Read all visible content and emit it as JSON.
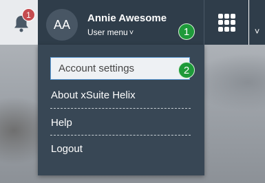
{
  "notifications": {
    "count": "1",
    "icon": "bell-icon"
  },
  "user": {
    "initials": "AA",
    "name": "Annie Awesome",
    "menu_label": "User menu",
    "menu_chevron": "˅"
  },
  "markers": {
    "one": "1",
    "two": "2"
  },
  "apps": {
    "icon": "app-grid-icon",
    "chevron": "˅"
  },
  "user_menu_items": {
    "account_settings": "Account settings",
    "about": "About xSuite Helix",
    "help": "Help",
    "logout": "Logout"
  },
  "colors": {
    "topbar": "#2f3d4a",
    "menu": "#384755",
    "badge": "#c54b4f",
    "marker": "#1e9a3a",
    "highlight_border": "#5b9bd5"
  }
}
